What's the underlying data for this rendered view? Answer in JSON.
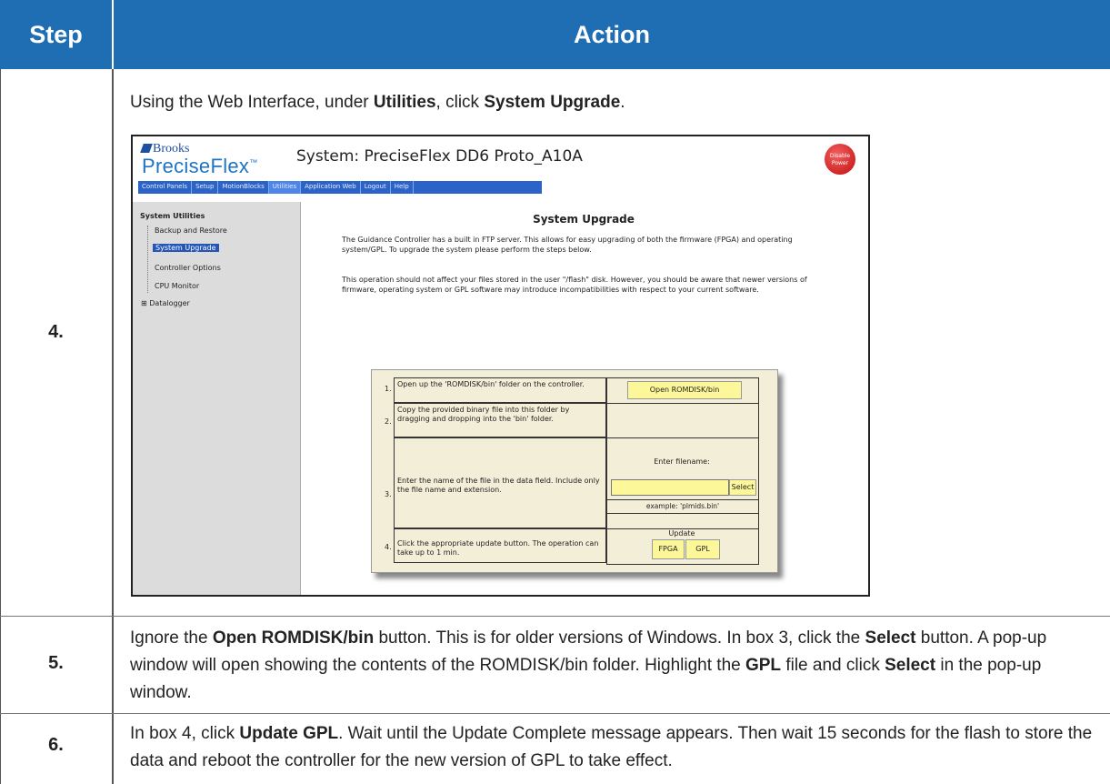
{
  "header": {
    "step": "Step",
    "action": "Action"
  },
  "rows": [
    {
      "step": "4.",
      "text_parts": {
        "a": "Using the Web Interface, under ",
        "b": "Utilities",
        "c": ", click ",
        "d": "System Upgrade",
        "e": "."
      }
    },
    {
      "step": "5.",
      "text_parts": {
        "a": "Ignore the ",
        "b": "Open ROMDISK/bin",
        "c": " button. This is for older versions of Windows. In box 3, click the ",
        "d": "Select",
        "e": " button. A pop-up window will open showing the contents of the ROMDISK/bin folder. Highlight the ",
        "f": "GPL",
        "g": " file and click ",
        "h": "Select",
        "i": " in the pop-up window."
      }
    },
    {
      "step": "6.",
      "text_parts": {
        "a": "In box 4, click ",
        "b": "Update GPL",
        "c": ". Wait until the Update Complete message appears. Then wait 15 seconds for the flash to store the data and reboot the controller for the new version of GPL to take effect."
      }
    }
  ],
  "screenshot": {
    "logo_top": "Brooks",
    "logo_main": "PreciseFlex",
    "logo_tm": "™",
    "system_title": "System: PreciseFlex DD6 Proto_A10A",
    "disable_power": "Disable Power",
    "nav": [
      "Control Panels",
      "Setup",
      "MotionBlocks",
      "Utilities",
      "Application Web",
      "Logout",
      "Help"
    ],
    "nav_active": "Utilities",
    "sidebar": {
      "title": "System Utilities",
      "items": [
        "Backup and Restore",
        "System Upgrade",
        "Controller Options",
        "CPU Monitor",
        "Datalogger"
      ],
      "selected": "System Upgrade",
      "expand_glyph": "⊞"
    },
    "content_title": "System Upgrade",
    "paragraph1": "The Guidance Controller has a built in FTP server. This allows for easy upgrading of both the firmware (FPGA) and operating system/GPL. To upgrade the system please perform the steps below.",
    "paragraph2": "This operation should not affect your files stored in the user \"/flash\" disk.  However, you should be aware that newer versions of firmware, operating system or GPL software may introduce incompatibilities with respect to your current software.",
    "steps": [
      {
        "n": "1.",
        "text": "Open up the 'ROMDISK/bin' folder on the controller.",
        "button": "Open ROMDISK/bin"
      },
      {
        "n": "2.",
        "text": "Copy the provided binary file into this folder by dragging and dropping into the 'bin' folder."
      },
      {
        "n": "3.",
        "text": "Enter the name of the file in the data field. Include only the file name and extension.",
        "label": "Enter filename:",
        "button": "Select",
        "example": "example: 'plmids.bin'"
      },
      {
        "n": "4.",
        "text": "Click the appropriate update button. The operation can take up to 1 min.",
        "label": "Update",
        "buttons": [
          "FPGA",
          "GPL"
        ]
      }
    ]
  }
}
